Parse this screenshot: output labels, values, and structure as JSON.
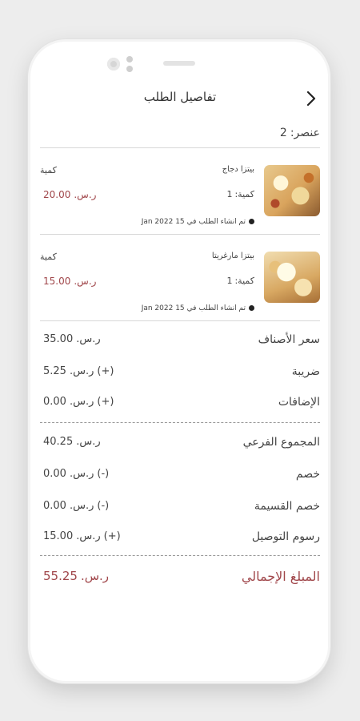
{
  "header": {
    "title": "تفاصيل الطلب"
  },
  "items_count": {
    "label": "عنصر:",
    "value": "2"
  },
  "items": [
    {
      "name": "بيتزا دجاج",
      "qty_header": "كمية",
      "qty_label": "كمية:",
      "qty_value": "1",
      "currency": "ر.س.",
      "price": "20.00",
      "created_label": "تم انشاء الطلب في",
      "created_date": "15 Jan 2022"
    },
    {
      "name": "بيتزا مارغريتا",
      "qty_header": "كمية",
      "qty_label": "كمية:",
      "qty_value": "1",
      "currency": "ر.س.",
      "price": "15.00",
      "created_label": "تم انشاء الطلب في",
      "created_date": "15 Jan 2022"
    }
  ],
  "summary": {
    "items_price": {
      "label": "سعر الأصناف",
      "sign": "",
      "currency": "ر.س.",
      "value": "35.00"
    },
    "tax": {
      "label": "ضريبة",
      "sign": "(+)",
      "currency": "ر.س.",
      "value": "5.25"
    },
    "addons": {
      "label": "الإضافات",
      "sign": "(+)",
      "currency": "ر.س.",
      "value": "0.00"
    },
    "subtotal": {
      "label": "المجموع الفرعي",
      "sign": "",
      "currency": "ر.س.",
      "value": "40.25"
    },
    "discount": {
      "label": "خصم",
      "sign": "(-)",
      "currency": "ر.س.",
      "value": "0.00"
    },
    "coupon_discount": {
      "label": "خصم القسيمة",
      "sign": "(-)",
      "currency": "ر.س.",
      "value": "0.00"
    },
    "delivery_fee": {
      "label": "رسوم التوصيل",
      "sign": "(+)",
      "currency": "ر.س.",
      "value": "15.00"
    },
    "total": {
      "label": "المبلغ الإجمالي",
      "currency": "ر.س.",
      "value": "55.25"
    }
  },
  "colors": {
    "accent": "#a0464a",
    "text": "#444444",
    "divider": "#d8d8d8"
  },
  "icons": {
    "back": "chevron-right-icon",
    "bullet": "dot-icon"
  }
}
